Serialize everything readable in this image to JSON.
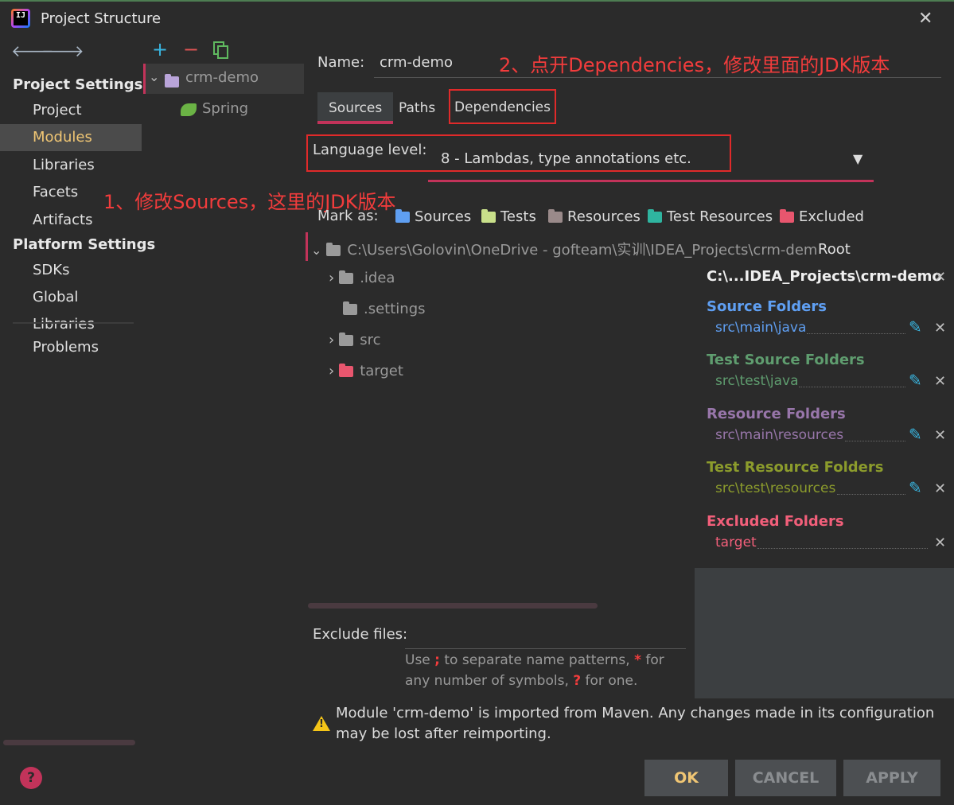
{
  "window": {
    "title": "Project Structure"
  },
  "sidebar": {
    "project_settings_header": "Project Settings",
    "project_items": [
      "Project",
      "Modules",
      "Libraries",
      "Facets",
      "Artifacts"
    ],
    "platform_settings_header": "Platform Settings",
    "platform_items": [
      "SDKs",
      "Global Libraries"
    ],
    "problems": "Problems",
    "selected": "Modules"
  },
  "module_tree": {
    "module": "crm-demo",
    "facet": "Spring"
  },
  "module": {
    "name_label": "Name:",
    "name_value": "crm-demo",
    "tabs": [
      "Sources",
      "Paths",
      "Dependencies"
    ],
    "active_tab": "Sources",
    "language_level_label": "Language level:",
    "language_level_value": "8 - Lambdas, type annotations etc.",
    "mark_as_label": "Mark as:",
    "mark_as_options": [
      "Sources",
      "Tests",
      "Resources",
      "Test Resources",
      "Excluded"
    ],
    "root_path": "C:\\Users\\Golovin\\OneDrive - gofteam\\实训\\IDEA_Projects\\crm-demo",
    "root_tag": "Root",
    "children": [
      ".idea",
      ".settings",
      "src",
      "target"
    ],
    "exclude_files_label": "Exclude files:",
    "exclude_hint_1a": "Use",
    "exclude_hint_1b": ";",
    "exclude_hint_1c": "to separate name patterns,",
    "exclude_hint_1d": "*",
    "exclude_hint_1e": "for",
    "exclude_hint_2a": "any number of symbols,",
    "exclude_hint_2b": "?",
    "exclude_hint_2c": "for one.",
    "warning_line1": "Module 'crm-demo' is imported from Maven. Any changes made in its configuration",
    "warning_line2": "may be lost after reimporting."
  },
  "content_roots": {
    "header": "C:\\...IDEA_Projects\\crm-demo",
    "source_folders_label": "Source Folders",
    "source_folder": "src\\main\\java",
    "test_source_folders_label": "Test Source Folders",
    "test_source_folder": "src\\test\\java",
    "resource_folders_label": "Resource Folders",
    "resource_folder": "src\\main\\resources",
    "test_resource_folders_label": "Test Resource Folders",
    "test_resource_folder": "src\\test\\resources",
    "excluded_folders_label": "Excluded Folders",
    "excluded_folder": "target"
  },
  "annotations": {
    "note1": "1、修改Sources，这里的JDK版本",
    "note2": "2、点开Dependencies，修改里面的JDK版本"
  },
  "buttons": {
    "ok": "OK",
    "cancel": "CANCEL",
    "apply": "APPLY"
  },
  "colors": {
    "accent_pink": "#c2335a",
    "annotation_red": "#f23c3c",
    "source_blue": "#5f9ff2",
    "test_green": "#5f9d6f",
    "resource_purple": "#9876aa",
    "test_resource_olive": "#8c9c2c",
    "excluded_red": "#f25f7a",
    "selected_yellow": "#f0c674"
  }
}
